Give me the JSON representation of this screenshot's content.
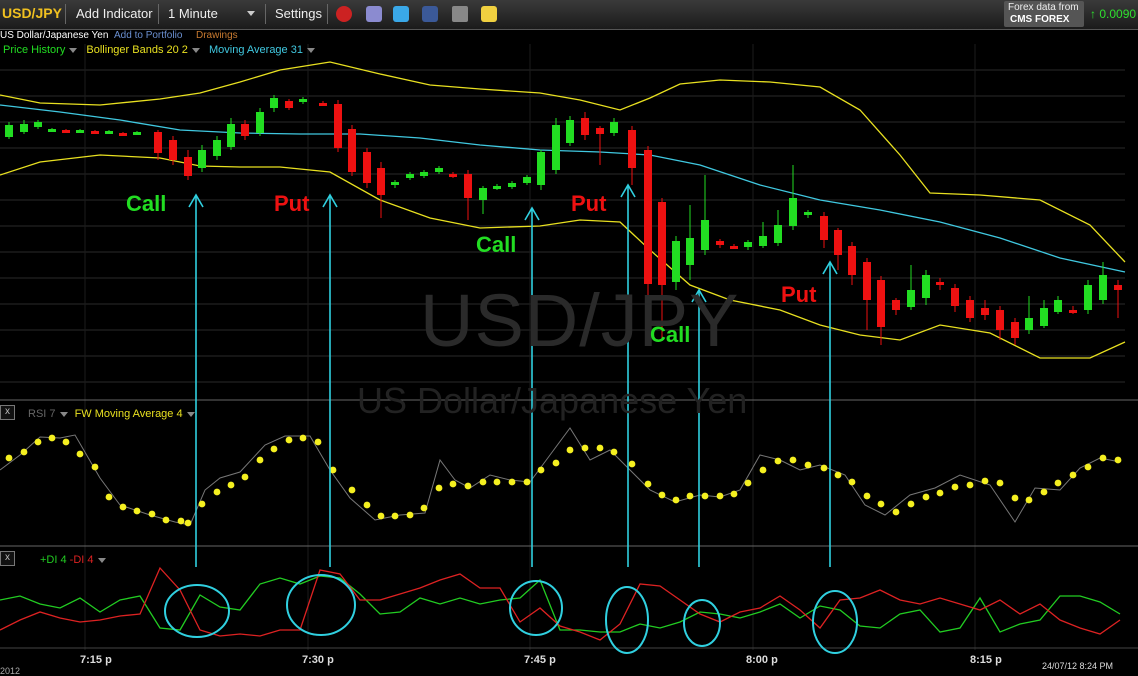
{
  "toolbar": {
    "symbol": "USD/JPY",
    "add_indicator": "Add Indicator",
    "interval": "1 Minute",
    "settings": "Settings",
    "icons": [
      "alarm-clock-icon",
      "stack-icon",
      "twitter-icon",
      "facebook-icon",
      "camera-icon",
      "note-icon"
    ]
  },
  "data_source": {
    "label": "Forex data from",
    "provider": "CMS FOREX"
  },
  "quote": {
    "change": "↑ 0.0090",
    "color": "#2ee02e"
  },
  "subbar": {
    "name": "US Dollar/Japanese Yen",
    "add_to_portfolio": "Add to Portfolio",
    "drawings": "Drawings"
  },
  "price_legend": {
    "price_history": "Price History",
    "bollinger": "Bollinger Bands 20 2",
    "moving_average": "Moving Average 31"
  },
  "rsi_legend": {
    "close": "x",
    "rsi": "RSI 7",
    "fw_ma": "FW Moving Average 4"
  },
  "di_legend": {
    "close": "x",
    "plus_di": "+DI 4",
    "minus_di": "-DI 4"
  },
  "watermark": {
    "symbol": "USD/JPY",
    "name": "US Dollar/Japanese Yen"
  },
  "signals": [
    {
      "label": "Call",
      "type": "call"
    },
    {
      "label": "Put",
      "type": "put"
    },
    {
      "label": "Call",
      "type": "call"
    },
    {
      "label": "Put",
      "type": "put"
    },
    {
      "label": "Call",
      "type": "call"
    },
    {
      "label": "Put",
      "type": "put"
    }
  ],
  "x_axis": {
    "ticks": [
      "7:15 p",
      "7:30 p",
      "7:45 p",
      "8:00 p",
      "8:15 p"
    ]
  },
  "timestamp": "24/07/12 8:24 PM",
  "year_fragment": "2012",
  "colors": {
    "up": "#22dd22",
    "down": "#ee1111",
    "bollinger": "#e8e020",
    "ma": "#40c8e0",
    "rsi_dots": "#f5f020",
    "arrow": "#30d0e0",
    "plus_di": "#22cc22",
    "minus_di": "#dd2222"
  }
}
